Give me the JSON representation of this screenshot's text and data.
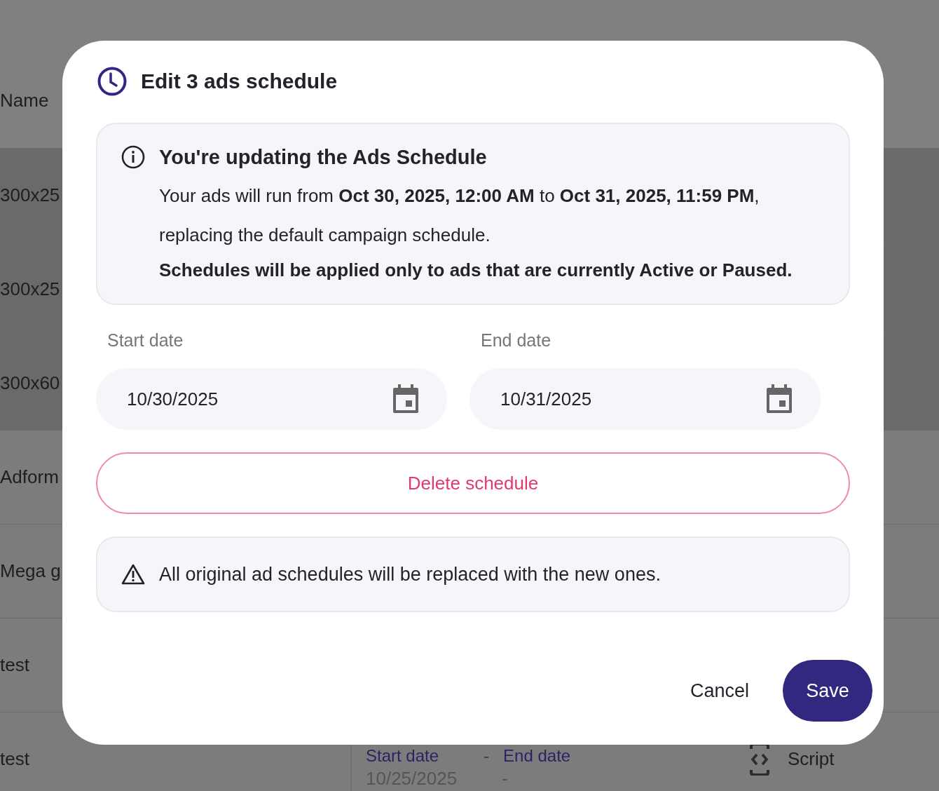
{
  "background_table": {
    "header": "Name",
    "rows": [
      {
        "name": "300x25",
        "selected": true
      },
      {
        "name": "300x25",
        "selected": true
      },
      {
        "name": "300x60",
        "selected": true
      },
      {
        "name": "Adform",
        "selected": false
      },
      {
        "name": "Mega g",
        "selected": false
      },
      {
        "name": "test",
        "selected": false
      },
      {
        "name": "test",
        "selected": false,
        "schedule": {
          "start_label": "Start date",
          "separator": "-",
          "end_label": "End date",
          "start_value": "10/25/2025",
          "end_value": "-"
        },
        "type": "Script"
      }
    ]
  },
  "dialog": {
    "title": "Edit 3 ads schedule",
    "info": {
      "title": "You're updating the Ads Schedule",
      "text": "Your ads will run from **Oct 30, 2025, 12:00 AM** to **Oct 31, 2025, 11:59 PM**, replacing the default campaign schedule.",
      "note": "Schedules will be applied only to ads that are currently Active or Paused."
    },
    "start_date": {
      "label": "Start date",
      "value": "10/30/2025"
    },
    "end_date": {
      "label": "End date",
      "value": "10/31/2025"
    },
    "delete_button": "Delete schedule",
    "warning": "All original ad schedules will be replaced with the new ones.",
    "buttons": {
      "cancel": "Cancel",
      "save": "Save"
    }
  }
}
